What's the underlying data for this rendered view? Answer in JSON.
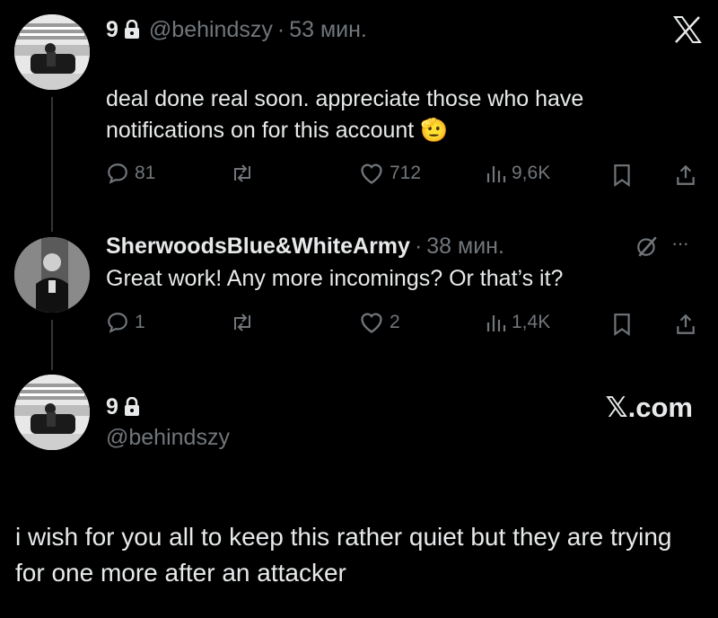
{
  "tweet1": {
    "handle": "@behindszy",
    "separator": "·",
    "time": "53 мин.",
    "badge": "9",
    "text": "deal done real soon. appreciate those who have notifications on for this account 🫡",
    "stats": {
      "replies": "81",
      "likes": "712",
      "views": "9,6K"
    }
  },
  "reply": {
    "name": "SherwoodsBlue&WhiteArmy",
    "separator": "·",
    "time": "38 мин.",
    "more": "···",
    "text": "Great work! Any more incomings? Or that’s it?",
    "stats": {
      "replies": "1",
      "likes": "2",
      "views": "1,4K"
    }
  },
  "card": {
    "badge": "9",
    "handle": "@behindszy",
    "site": "𝕏.com",
    "text": "i wish for you all to keep this rather quiet but they are trying for one more after an attacker"
  },
  "colors": {
    "bg": "#000000",
    "text": "#e7e9ea",
    "muted": "#71767b"
  }
}
